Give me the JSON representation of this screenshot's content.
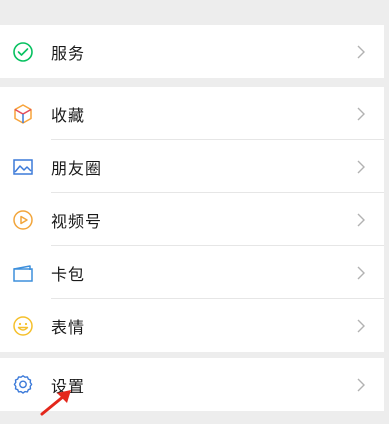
{
  "groups": [
    {
      "items": [
        {
          "label": "服务",
          "icon": "service-icon",
          "color": "#07c160"
        }
      ]
    },
    {
      "items": [
        {
          "label": "收藏",
          "icon": "favorites-cube-icon",
          "color": "#f7a43a"
        },
        {
          "label": "朋友圈",
          "icon": "moments-picture-icon",
          "color": "#3c7ad9"
        },
        {
          "label": "视频号",
          "icon": "channels-play-icon",
          "color": "#f2a53b"
        },
        {
          "label": "卡包",
          "icon": "card-wallet-icon",
          "color": "#3d8fdc"
        },
        {
          "label": "表情",
          "icon": "sticker-smiley-icon",
          "color": "#f5c02c"
        }
      ]
    },
    {
      "items": [
        {
          "label": "设置",
          "icon": "settings-gear-icon",
          "color": "#3c7ad9"
        }
      ]
    }
  ],
  "annotation": {
    "icon": "red-arrow-icon",
    "color": "#e3271b"
  }
}
